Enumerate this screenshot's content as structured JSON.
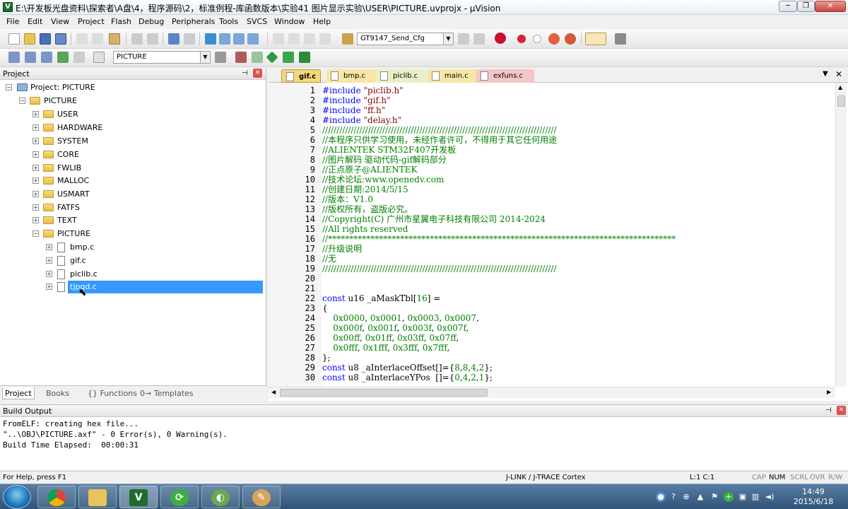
{
  "window": {
    "title": "E:\\开发板光盘资料\\探索者\\A盘\\4，程序源码\\2，标准例程-库函数版本\\实验41 图片显示实验\\USER\\PICTURE.uvprojx - µVision",
    "min": "─",
    "max": "❐",
    "close": "✕"
  },
  "menu": [
    "File",
    "Edit",
    "View",
    "Project",
    "Flash",
    "Debug",
    "Peripherals",
    "Tools",
    "SVCS",
    "Window",
    "Help"
  ],
  "toolbar": {
    "config_combo": "GT9147_Send_Cfg",
    "target_combo": "PICTURE"
  },
  "project_panel": {
    "title": "Project",
    "root": "Project: PICTURE",
    "target": "PICTURE",
    "groups": [
      "USER",
      "HARDWARE",
      "SYSTEM",
      "CORE",
      "FWLIB",
      "MALLOC",
      "USMART",
      "FATFS",
      "TEXT",
      "PICTURE"
    ],
    "files": [
      "bmp.c",
      "gif.c",
      "piclib.c",
      "tjpgd.c"
    ],
    "tabs": [
      "Project",
      "Books",
      "{} Functions",
      "0→ Templates"
    ]
  },
  "editor": {
    "tabs": [
      {
        "label": "gif.c",
        "color": "#f4d77a"
      },
      {
        "label": "bmp.c",
        "color": "#f7e6a6"
      },
      {
        "label": "piclib.c",
        "color": "#e9f0c8"
      },
      {
        "label": "main.c",
        "color": "#f7e6a6"
      },
      {
        "label": "exfuns.c",
        "color": "#f6c6c6"
      }
    ],
    "lines": [
      [
        [
          "pp",
          "#include "
        ],
        [
          "str",
          "\"piclib.h\""
        ]
      ],
      [
        [
          "pp",
          "#include "
        ],
        [
          "str",
          "\"gif.h\""
        ]
      ],
      [
        [
          "pp",
          "#include "
        ],
        [
          "str",
          "\"ff.h\""
        ]
      ],
      [
        [
          "pp",
          "#include "
        ],
        [
          "str",
          "\"delay.h\""
        ]
      ],
      [
        [
          "cm",
          "//////////////////////////////////////////////////////////////////////////////////"
        ]
      ],
      [
        [
          "cm",
          "//本程序只供学习使用，未经作者许可，不得用于其它任何用途"
        ]
      ],
      [
        [
          "cm",
          "//ALIENTEK STM32F407开发板"
        ]
      ],
      [
        [
          "cm",
          "//图片解码 驱动代码-gif解码部分"
        ]
      ],
      [
        [
          "cm",
          "//正点原子@ALIENTEK"
        ]
      ],
      [
        [
          "cm",
          "//技术论坛:www.openedv.com"
        ]
      ],
      [
        [
          "cm",
          "//创建日期:2014/5/15"
        ]
      ],
      [
        [
          "cm",
          "//版本：V1.0"
        ]
      ],
      [
        [
          "cm",
          "//版权所有，盗版必究。"
        ]
      ],
      [
        [
          "cm",
          "//Copyright(C) 广州市星翼电子科技有限公司 2014-2024"
        ]
      ],
      [
        [
          "cm",
          "//All rights reserved"
        ]
      ],
      [
        [
          "cm",
          "//**********************************************************************************"
        ]
      ],
      [
        [
          "cm",
          "//升级说明"
        ]
      ],
      [
        [
          "cm",
          "//无"
        ]
      ],
      [
        [
          "cm",
          "//////////////////////////////////////////////////////////////////////////////////"
        ]
      ],
      [],
      [],
      [
        [
          "kw",
          "const "
        ],
        [
          "txt",
          "u16 _aMaskTbl["
        ],
        [
          "num",
          "16"
        ],
        [
          "txt",
          "] ="
        ]
      ],
      [
        [
          "txt",
          "{"
        ]
      ],
      [
        [
          "txt",
          "    "
        ],
        [
          "num",
          "0x0000"
        ],
        [
          "txt",
          ", "
        ],
        [
          "num",
          "0x0001"
        ],
        [
          "txt",
          ", "
        ],
        [
          "num",
          "0x0003"
        ],
        [
          "txt",
          ", "
        ],
        [
          "num",
          "0x0007"
        ],
        [
          "txt",
          ","
        ]
      ],
      [
        [
          "txt",
          "    "
        ],
        [
          "num",
          "0x000f"
        ],
        [
          "txt",
          ", "
        ],
        [
          "num",
          "0x001f"
        ],
        [
          "txt",
          ", "
        ],
        [
          "num",
          "0x003f"
        ],
        [
          "txt",
          ", "
        ],
        [
          "num",
          "0x007f"
        ],
        [
          "txt",
          ","
        ]
      ],
      [
        [
          "txt",
          "    "
        ],
        [
          "num",
          "0x00ff"
        ],
        [
          "txt",
          ", "
        ],
        [
          "num",
          "0x01ff"
        ],
        [
          "txt",
          ", "
        ],
        [
          "num",
          "0x03ff"
        ],
        [
          "txt",
          ", "
        ],
        [
          "num",
          "0x07ff"
        ],
        [
          "txt",
          ","
        ]
      ],
      [
        [
          "txt",
          "    "
        ],
        [
          "num",
          "0x0fff"
        ],
        [
          "txt",
          ", "
        ],
        [
          "num",
          "0x1fff"
        ],
        [
          "txt",
          ", "
        ],
        [
          "num",
          "0x3fff"
        ],
        [
          "txt",
          ", "
        ],
        [
          "num",
          "0x7fff"
        ],
        [
          "txt",
          ","
        ]
      ],
      [
        [
          "txt",
          "};"
        ]
      ],
      [
        [
          "kw",
          "const "
        ],
        [
          "txt",
          "u8 _aInterlaceOffset[]={"
        ],
        [
          "num",
          "8"
        ],
        [
          "txt",
          ","
        ],
        [
          "num",
          "8"
        ],
        [
          "txt",
          ","
        ],
        [
          "num",
          "4"
        ],
        [
          "txt",
          ","
        ],
        [
          "num",
          "2"
        ],
        [
          "txt",
          "};"
        ]
      ],
      [
        [
          "kw",
          "const "
        ],
        [
          "txt",
          "u8 _aInterlaceYPos  []={"
        ],
        [
          "num",
          "0"
        ],
        [
          "txt",
          ","
        ],
        [
          "num",
          "4"
        ],
        [
          "txt",
          ","
        ],
        [
          "num",
          "2"
        ],
        [
          "txt",
          ","
        ],
        [
          "num",
          "1"
        ],
        [
          "txt",
          "};"
        ]
      ]
    ]
  },
  "build_output": {
    "title": "Build Output",
    "lines": [
      "FromELF: creating hex file...",
      "\"..\\OBJ\\PICTURE.axf\" - 0 Error(s), 0 Warning(s).",
      "Build Time Elapsed:  00:00:31"
    ]
  },
  "statusbar": {
    "help": "For Help, press F1",
    "debugger": "J-LINK / J-TRACE Cortex",
    "position": "L:1 C:1",
    "caps": "CAP",
    "num": "NUM",
    "scrl": "SCRL",
    "ovr": "OVR",
    "rw": "R/W"
  },
  "taskbar": {
    "time": "14:49",
    "date": "2015/6/18"
  }
}
